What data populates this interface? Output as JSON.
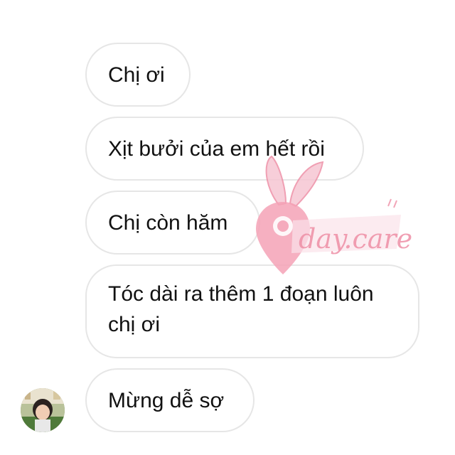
{
  "messages": [
    {
      "text": "Chị ơi"
    },
    {
      "text": "Xịt bưởi của em hết rồi"
    },
    {
      "text": "Chị còn hăm"
    },
    {
      "text": "Tóc dài ra thêm 1 đoạn luôn chị ơi"
    },
    {
      "text": "Mừng dễ sợ"
    }
  ],
  "watermark": {
    "text": "day.care",
    "color": "#ee8fa6"
  },
  "bubble": {
    "border_color": "#e6e6e6",
    "text_color": "#111111"
  }
}
